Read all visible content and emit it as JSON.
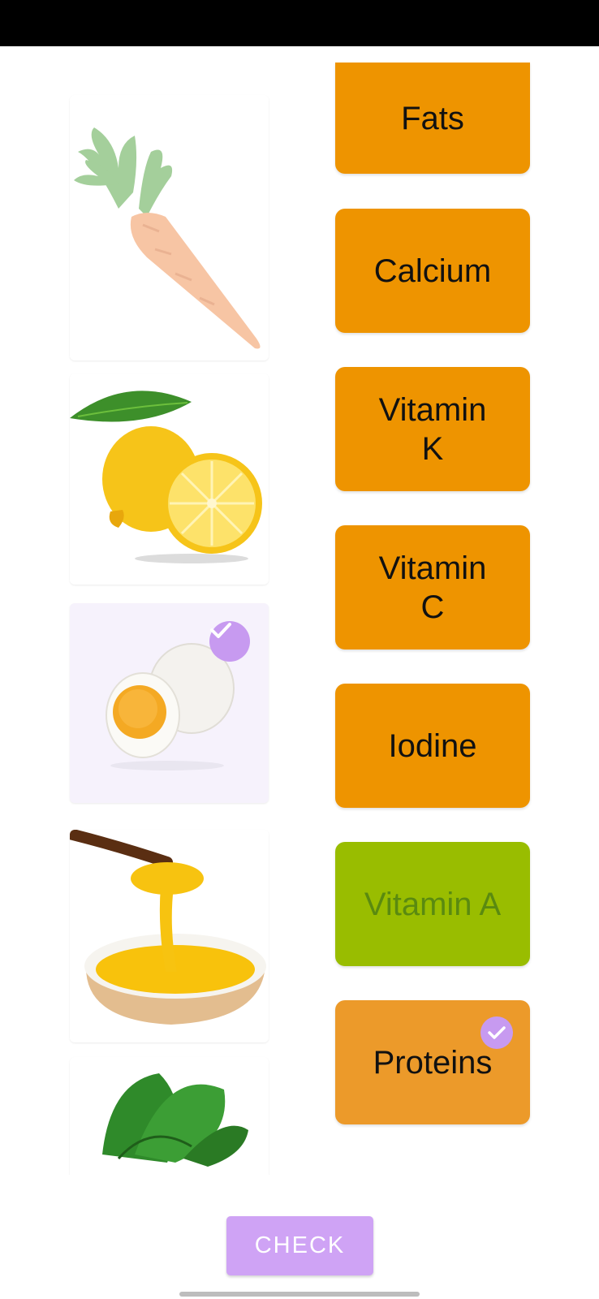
{
  "colors": {
    "nutrient_default": "#ee9400",
    "nutrient_correct": "#99bd00",
    "nutrient_correct_text": "#5a8a10",
    "nutrient_selected": "#ec9a2a",
    "check_accent": "#c79af0",
    "check_button": "#cfa3f5"
  },
  "foods": [
    {
      "name": "carrot",
      "selected": false,
      "faded": true
    },
    {
      "name": "lemon",
      "selected": false
    },
    {
      "name": "egg",
      "selected": true
    },
    {
      "name": "ghee",
      "selected": false
    },
    {
      "name": "spinach",
      "selected": false
    }
  ],
  "nutrients": [
    {
      "label": "Fats",
      "state": "default"
    },
    {
      "label": "Calcium",
      "state": "default"
    },
    {
      "label": "Vitamin K",
      "state": "default"
    },
    {
      "label": "Vitamin C",
      "state": "default"
    },
    {
      "label": "Iodine",
      "state": "default"
    },
    {
      "label": "Vitamin A",
      "state": "correct"
    },
    {
      "label": "Proteins",
      "state": "selected"
    }
  ],
  "check_button": {
    "label": "CHECK"
  }
}
